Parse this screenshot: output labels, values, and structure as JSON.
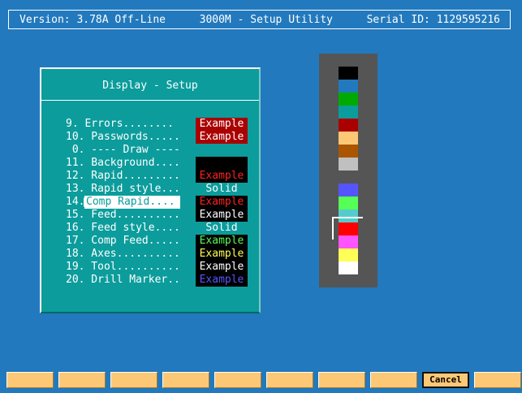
{
  "header": {
    "version": "Version: 3.78A Off-Line",
    "title": "3000M - Setup Utility",
    "serial": "Serial ID: 1129595216"
  },
  "dialog": {
    "title": "Display - Setup",
    "rows": [
      {
        "label": "9. Errors........",
        "example": "Example",
        "fg": "#ffffff",
        "bg": "#aa0000"
      },
      {
        "label": "10. Passwords.....",
        "example": "Example",
        "fg": "#ffffff",
        "bg": "#aa0000"
      },
      {
        "label": " 0. ---- Draw ----",
        "example": "",
        "fg": "",
        "bg": ""
      },
      {
        "label": "11. Background....",
        "example": "",
        "fg": "",
        "bg": "#000000"
      },
      {
        "label": "12. Rapid.........",
        "example": "Example",
        "fg": "#ff2020",
        "bg": "#000000"
      },
      {
        "label": "13. Rapid style...",
        "example": "Solid",
        "fg": "#ffffff",
        "bg": ""
      },
      {
        "label": "Comp Rapid....",
        "number": "14.",
        "selected": true,
        "example": "Example",
        "fg": "#ff2020",
        "bg": "#000000"
      },
      {
        "label": "15. Feed..........",
        "example": "Example",
        "fg": "#ffffff",
        "bg": "#000000"
      },
      {
        "label": "16. Feed style....",
        "example": "Solid",
        "fg": "#ffffff",
        "bg": ""
      },
      {
        "label": "17. Comp Feed.....",
        "example": "Example",
        "fg": "#55ff55",
        "bg": "#000000"
      },
      {
        "label": "18. Axes..........",
        "example": "Example",
        "fg": "#ffff55",
        "bg": "#000000"
      },
      {
        "label": "19. Tool..........",
        "example": "Example",
        "fg": "#ffffff",
        "bg": "#000000"
      },
      {
        "label": "20. Drill Marker..",
        "example": "Example",
        "fg": "#5555ff",
        "bg": "#000000"
      }
    ]
  },
  "palette": {
    "colors": [
      "#000000",
      "#2279bd",
      "#00aa00",
      "#0c9c9c",
      "#aa0000",
      "#fdc875",
      "#aa5500",
      "#c0c0c0",
      "#555555",
      "#5555ff",
      "#55ff55",
      "#55cccc",
      "#ff0000",
      "#ff55ff",
      "#ffff55",
      "#ffffff"
    ]
  },
  "fkeys": {
    "labels": [
      "",
      "",
      "",
      "",
      "",
      "",
      "",
      "",
      "Cancel",
      ""
    ]
  }
}
